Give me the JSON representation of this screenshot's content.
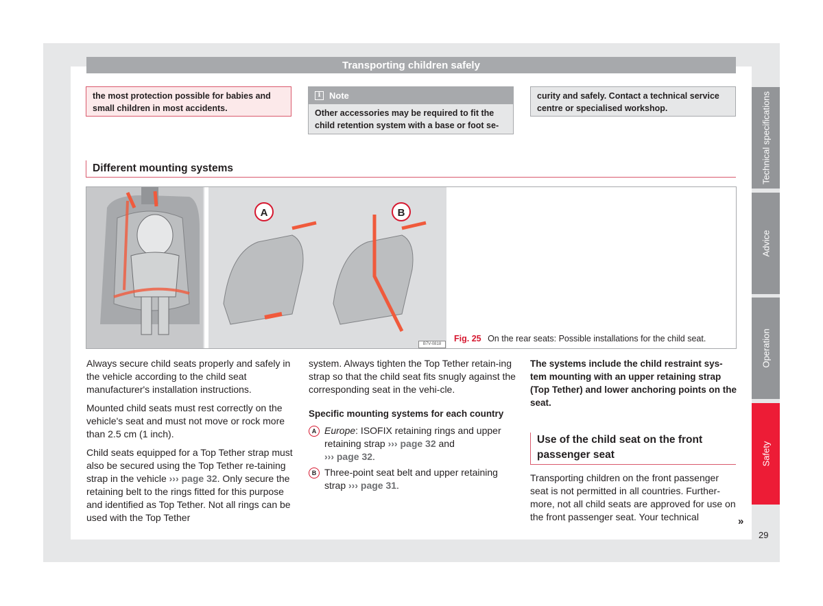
{
  "header": {
    "title": "Transporting children safely"
  },
  "warning_box": {
    "text": "the most protection possible for babies and small children in most accidents."
  },
  "note_box": {
    "icon": "info-icon",
    "title": "Note",
    "text": "Other accessories may be required to fit the child retention system with a base or foot se-"
  },
  "continuation_box": {
    "text": "curity and safely. Contact a technical service centre or specialised workshop."
  },
  "section": {
    "title": "Different mounting systems"
  },
  "figure": {
    "label": "Fig. 25",
    "caption": "On the rear seats: Possible installations for the child seat.",
    "code": "B7V-0818",
    "markers": [
      "A",
      "B"
    ]
  },
  "column1": {
    "paragraphs": [
      "Always secure child seats properly and safely in the vehicle according to the child seat manufacturer's installation instructions.",
      "Mounted child seats must rest correctly on the vehicle's seat and must not move or rock more than 2.5 cm (1 inch)."
    ],
    "para3_start": "Child seats equipped for a Top Tether strap must also be secured using the Top Tether re-taining strap in the vehicle ",
    "para3_ref": "››› page 32",
    "para3_end": ". Only secure the retaining belt to the rings fitted for this purpose and identified as Top Tether. Not all rings can be used with the Top Tether"
  },
  "column2": {
    "paragraph": "system. Always tighten the Top Tether retain-ing strap so that the child seat fits snugly against the corresponding seat in the vehi-cle.",
    "subheading": "Specific mounting systems for each country",
    "items": [
      {
        "marker": "A",
        "italic": "Europe",
        "text": ": ISOFIX retaining rings and upper retaining strap ",
        "ref1": "››› page 32",
        "mid": " and ",
        "ref2": "››› page 32",
        "end": "."
      },
      {
        "marker": "B",
        "text": "Three-point seat belt and upper retaining strap ",
        "ref1": "››› page 31",
        "end": "."
      }
    ]
  },
  "column3": {
    "bold_paragraph": "The systems include the child restraint sys-tem mounting with an upper retaining strap (Top Tether) and lower anchoring points on the seat.",
    "subtitle": "Use of the child seat on the front passenger seat",
    "paragraph": "Transporting children on the front passenger seat is not permitted in all countries. Further-more, not all child seats are approved for use on the front passenger seat. Your technical",
    "more_indicator": "»"
  },
  "side_tabs": [
    {
      "label": "Technical specifications",
      "active": false
    },
    {
      "label": "Advice",
      "active": false
    },
    {
      "label": "Operation",
      "active": false
    },
    {
      "label": "Safety",
      "active": true
    }
  ],
  "colors": {
    "accent_red": "#ed1c36",
    "tab_gray": "#939598",
    "header_gray": "#a7a9ac"
  },
  "page_number": "29"
}
